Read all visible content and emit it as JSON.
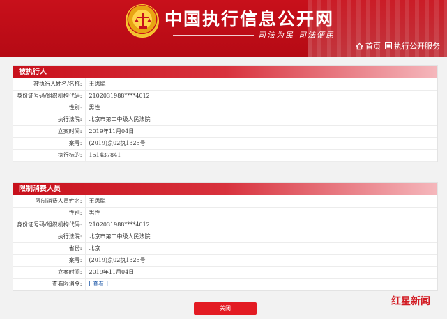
{
  "header": {
    "site_title": "中国执行信息公开网",
    "slogan_1": "司法为民",
    "slogan_2": "司法便民",
    "nav_home": "首页",
    "nav_exec": "执行公开服务"
  },
  "debtor_panel": {
    "title": "被执行人",
    "rows": [
      {
        "label": "被执行人姓名/名称:",
        "value": "王思聪"
      },
      {
        "label": "身份证号码/组织机构代码:",
        "value": "2102031988****4012"
      },
      {
        "label": "性别:",
        "value": "男性"
      },
      {
        "label": "执行法院:",
        "value": "北京市第二中级人民法院"
      },
      {
        "label": "立案时间:",
        "value": "2019年11月04日"
      },
      {
        "label": "案号:",
        "value": "(2019)京02执1325号"
      },
      {
        "label": "执行标的:",
        "value": "151437841"
      }
    ]
  },
  "restricted_panel": {
    "title": "限制消费人员",
    "rows": [
      {
        "label": "限制消费人员姓名:",
        "value": "王思聪"
      },
      {
        "label": "性别:",
        "value": "男性"
      },
      {
        "label": "身份证号码/组织机构代码:",
        "value": "2102031988****4012"
      },
      {
        "label": "执行法院:",
        "value": "北京市第二中级人民法院"
      },
      {
        "label": "省份:",
        "value": "北京"
      },
      {
        "label": "案号:",
        "value": "(2019)京02执1325号"
      },
      {
        "label": "立案时间:",
        "value": "2019年11月04日"
      },
      {
        "label": "查看限消令:",
        "value": "[ 查看 ]"
      }
    ]
  },
  "close_label": "关闭",
  "watermark": "红星新闻",
  "icons": {
    "home": "home-icon",
    "grid": "grid-icon",
    "emblem": "court-emblem-icon"
  },
  "colors": {
    "brand_red": "#c8101b",
    "button_red": "#e31b23",
    "link_blue": "#1a55a6"
  }
}
